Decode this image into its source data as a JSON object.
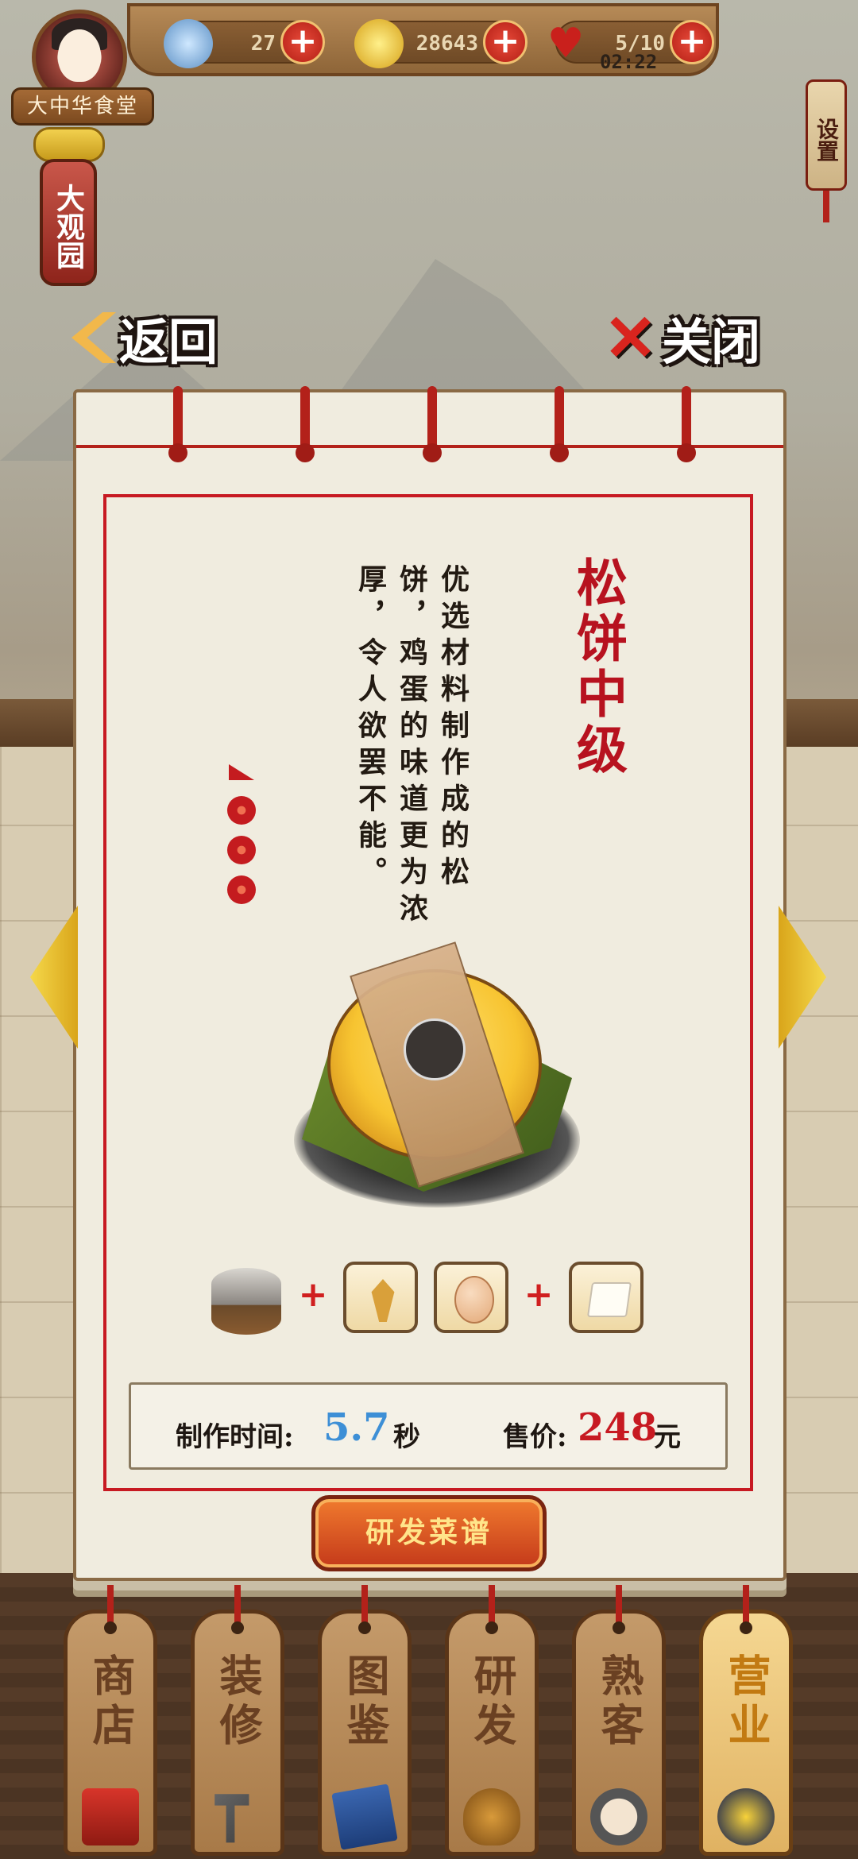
{
  "topbar": {
    "ingots": "27",
    "coins": "28643",
    "hearts": "5/10",
    "timer": "02:22"
  },
  "restaurant_name": "大中华食堂",
  "area_sign": "大观园",
  "settings_label": "设置",
  "back_label": "返回",
  "close_label": "关闭",
  "recipe": {
    "title": "松饼中级",
    "description": "优选材料制作成的松饼，鸡蛋的味道更为浓厚，令人欲罢不能。",
    "rating_stars": 3,
    "ingredients": [
      {
        "name": "flour-drum-icon"
      },
      {
        "name": "wheat-icon"
      },
      {
        "name": "egg-icon"
      },
      {
        "name": "tofu-icon"
      }
    ],
    "time_label": "制作时间:",
    "time_value": "5.7",
    "time_unit": "秒",
    "price_label": "售价:",
    "price_value": "248",
    "price_unit": "元"
  },
  "research_button": "研发菜谱",
  "nav": [
    {
      "label": "商店",
      "icon": "shop-chest-icon"
    },
    {
      "label": "装修",
      "icon": "hammer-icon"
    },
    {
      "label": "图鉴",
      "icon": "book-icon"
    },
    {
      "label": "研发",
      "icon": "pot-icon"
    },
    {
      "label": "熟客",
      "icon": "customer-icon"
    },
    {
      "label": "营业",
      "icon": "wok-icon"
    }
  ],
  "colors": {
    "accent_red": "#c71a22",
    "time_blue": "#3d8fd6",
    "price_red": "#c71a22",
    "active_tab": "#c27a12"
  }
}
